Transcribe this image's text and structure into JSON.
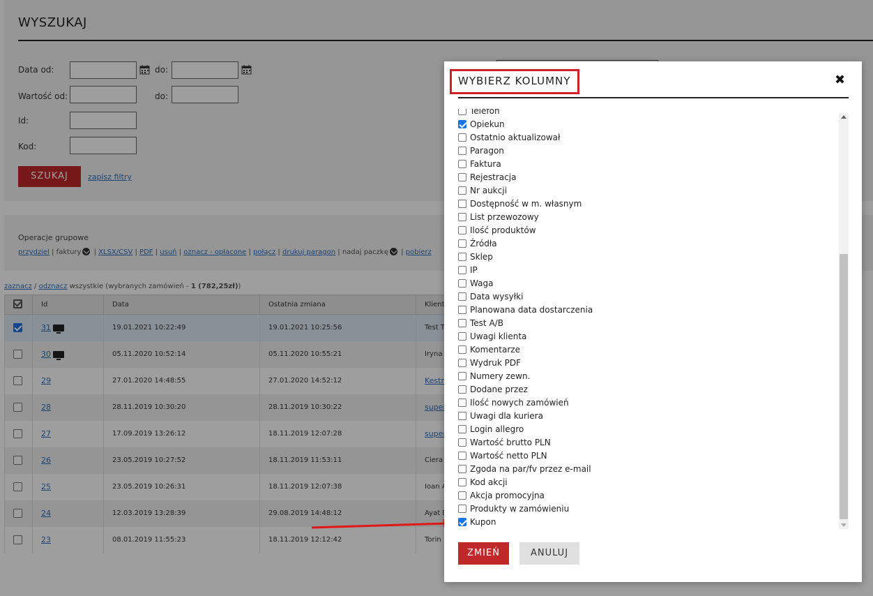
{
  "search": {
    "title": "WYSZUKAJ",
    "date_from_label": "Data od:",
    "date_to_label": "do:",
    "value_from_label": "Wartość od:",
    "value_to_label": "do:",
    "id_label": "Id:",
    "code_label": "Kod:",
    "search_button": "SZUKAJ",
    "save_filters_link": "zapisz filtry"
  },
  "group_ops": {
    "title": "Operacje grupowe",
    "assign": "przydziel",
    "invoices": "faktury",
    "xlsx": "XLSX/CSV",
    "pdf": "PDF",
    "delete": "usuń",
    "mark_paid": "oznacz - opłacone",
    "merge": "połącz",
    "print_receipt": "drukuj paragon",
    "send_package": "nadaj paczkę",
    "fetch": "pobierz"
  },
  "selection": {
    "select": "zaznacz",
    "sep": "/",
    "deselect": "odznacz",
    "rest": "wszystkie (wybranych zamówień - ",
    "count": "1 (782,25zł)",
    "close": ")"
  },
  "table": {
    "headers": {
      "id": "Id",
      "date": "Data",
      "last_change": "Ostatnia zmiana",
      "client": "Klient"
    },
    "rows": [
      {
        "id": "31",
        "date": "19.01.2021 10:22:49",
        "last_change": "19.01.2021 10:25:56",
        "client": "Test T",
        "checked": true
      },
      {
        "id": "30",
        "date": "05.11.2020 10:52:14",
        "last_change": "05.11.2020 10:55:21",
        "client": "Iryna",
        "checked": false
      },
      {
        "id": "29",
        "date": "27.01.2020 14:48:55",
        "last_change": "27.01.2020 14:52:12",
        "client": "Kestre",
        "checked": false
      },
      {
        "id": "28",
        "date": "28.11.2019 10:30:20",
        "last_change": "28.11.2019 10:30:22",
        "client": "super",
        "checked": false
      },
      {
        "id": "27",
        "date": "17.09.2019 13:26:12",
        "last_change": "18.11.2019 12:07:28",
        "client": "super",
        "checked": false
      },
      {
        "id": "26",
        "date": "23.05.2019 10:27:52",
        "last_change": "18.11.2019 11:53:11",
        "client": "Ciera",
        "checked": false
      },
      {
        "id": "25",
        "date": "23.05.2019 10:26:31",
        "last_change": "18.11.2019 12:07:38",
        "client": "Ioan A",
        "checked": false
      },
      {
        "id": "24",
        "date": "12.03.2019 13:28:39",
        "last_change": "29.08.2019 14:48:12",
        "client": "Ayat D",
        "checked": false
      },
      {
        "id": "23",
        "date": "08.01.2019 11:55:23",
        "last_change": "18.11.2019 12:12:42",
        "client": "Torin",
        "checked": false
      }
    ]
  },
  "modal": {
    "title": "WYBIERZ KOLUMNY",
    "close_glyph": "✖",
    "columns": [
      {
        "label": "Telefon",
        "checked": false
      },
      {
        "label": "Opiekun",
        "checked": true
      },
      {
        "label": "Ostatnio aktualizował",
        "checked": false
      },
      {
        "label": "Paragon",
        "checked": false
      },
      {
        "label": "Faktura",
        "checked": false
      },
      {
        "label": "Rejestracja",
        "checked": false
      },
      {
        "label": "Nr aukcji",
        "checked": false
      },
      {
        "label": "Dostępność w m. własnym",
        "checked": false
      },
      {
        "label": "List przewozowy",
        "checked": false
      },
      {
        "label": "Ilość produktów",
        "checked": false
      },
      {
        "label": "Źródła",
        "checked": false
      },
      {
        "label": "Sklep",
        "checked": false
      },
      {
        "label": "IP",
        "checked": false
      },
      {
        "label": "Waga",
        "checked": false
      },
      {
        "label": "Data wysyłki",
        "checked": false
      },
      {
        "label": "Planowana data dostarczenia",
        "checked": false
      },
      {
        "label": "Test A/B",
        "checked": false
      },
      {
        "label": "Uwagi klienta",
        "checked": false
      },
      {
        "label": "Komentarze",
        "checked": false
      },
      {
        "label": "Wydruk PDF",
        "checked": false
      },
      {
        "label": "Numery zewn.",
        "checked": false
      },
      {
        "label": "Dodane przez",
        "checked": false
      },
      {
        "label": "Ilość nowych zamówień",
        "checked": false
      },
      {
        "label": "Uwagi dla kuriera",
        "checked": false
      },
      {
        "label": "Login allegro",
        "checked": false
      },
      {
        "label": "Wartość brutto PLN",
        "checked": false
      },
      {
        "label": "Wartość netto PLN",
        "checked": false
      },
      {
        "label": "Zgoda na par/fv przez e-mail",
        "checked": false
      },
      {
        "label": "Kod akcji",
        "checked": false
      },
      {
        "label": "Akcja promocyjna",
        "checked": false
      },
      {
        "label": "Produkty w zamówieniu",
        "checked": false
      },
      {
        "label": "Kupon",
        "checked": true
      }
    ],
    "change_button": "ZMIEŃ",
    "cancel_button": "ANULUJ"
  },
  "colors": {
    "accent_red": "#c0282a",
    "highlight_red": "#d0202a",
    "checkbox_blue": "#1a73e8",
    "link_blue": "#2d6fbf"
  }
}
